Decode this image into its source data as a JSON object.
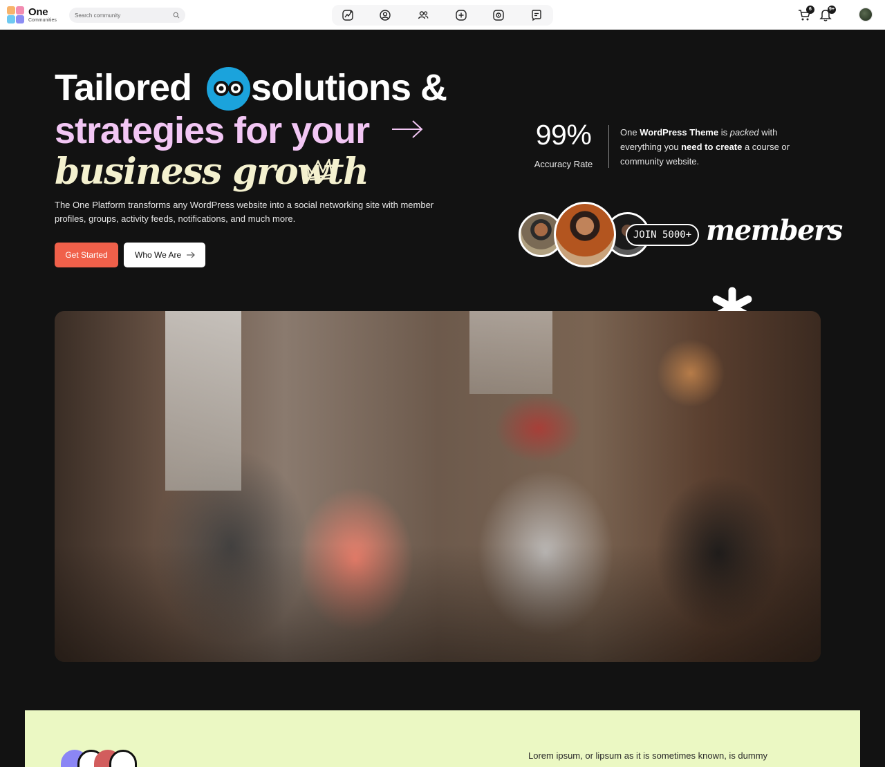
{
  "brand": {
    "name": "One",
    "tagline": "Communities"
  },
  "search": {
    "placeholder": "Search community"
  },
  "nav": {
    "items": [
      {
        "icon": "activity-icon"
      },
      {
        "icon": "profile-icon"
      },
      {
        "icon": "groups-icon"
      },
      {
        "icon": "add-icon"
      },
      {
        "icon": "camera-icon"
      },
      {
        "icon": "forums-icon"
      }
    ]
  },
  "header_actions": {
    "cart_count": "6",
    "notifications_count": "9+"
  },
  "hero": {
    "line1_a": "Tailored",
    "line1_b": "solutions &",
    "line2": "strategies for your",
    "line3": "business growth",
    "description": "The One Platform transforms any WordPress website into a social networking site with member profiles, groups, activity feeds, notifications, and much more.",
    "cta_primary": "Get Started",
    "cta_secondary": "Who We Are"
  },
  "stats": {
    "value": "99%",
    "label": "Accuracy Rate",
    "desc_1": "One ",
    "desc_2": "WordPress Theme",
    "desc_3": " is ",
    "desc_4": "packed",
    "desc_5": " with everything you ",
    "desc_6": "need to create",
    "desc_7": " a course or community website."
  },
  "members": {
    "join_label": "JOIN 5000+",
    "word": "members"
  },
  "colors": {
    "accent": "#f0604a",
    "hero_pink": "#f2c6f4",
    "hero_cream": "#f4f1cf",
    "eyes_blue": "#1ba3dc",
    "lime_bg": "#ebf8c3"
  },
  "lower": {
    "text": "Lorem ipsum, or lipsum as it is sometimes known, is dummy"
  }
}
